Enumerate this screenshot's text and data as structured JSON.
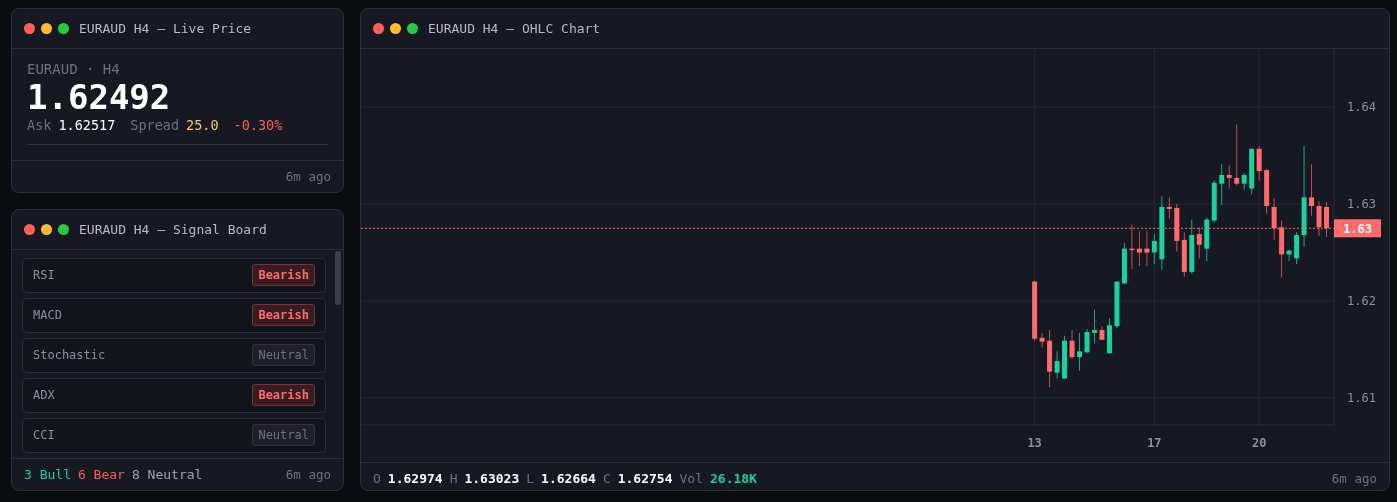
{
  "live_price": {
    "title": "EURAUD H4 — Live Price",
    "symbol": "EURAUD · H4",
    "price": "1.62492",
    "ask_label": "Ask",
    "ask": "1.62517",
    "spread_label": "Spread",
    "spread": "25.0",
    "change": "-0.30%",
    "updated": "6m ago"
  },
  "signal_board": {
    "title": "EURAUD H4 — Signal Board",
    "signals": [
      {
        "name": "RSI",
        "label": "Bearish",
        "kind": "bearish"
      },
      {
        "name": "MACD",
        "label": "Bearish",
        "kind": "bearish"
      },
      {
        "name": "Stochastic",
        "label": "Neutral",
        "kind": "neutral"
      },
      {
        "name": "ADX",
        "label": "Bearish",
        "kind": "bearish"
      },
      {
        "name": "CCI",
        "label": "Neutral",
        "kind": "neutral"
      }
    ],
    "summary": [
      {
        "text": "3 Bull",
        "kind": "bull"
      },
      {
        "text": "6 Bear",
        "kind": "bear"
      },
      {
        "text": "8 Neutral",
        "kind": "neutral"
      }
    ],
    "updated": "6m ago"
  },
  "ohlc_chart": {
    "title": "EURAUD H4 — OHLC Chart",
    "chart_data": {
      "type": "candlestick",
      "grid": true,
      "categories": [
        "13",
        null,
        null,
        null,
        null,
        null,
        null,
        null,
        null,
        null,
        null,
        null,
        null,
        null,
        null,
        null,
        "17",
        null,
        null,
        null,
        null,
        null,
        null,
        null,
        null,
        null,
        null,
        null,
        null,
        null,
        "20",
        null,
        null,
        null,
        null,
        null,
        null,
        null,
        null,
        null
      ],
      "ohlc": [
        [
          1.622,
          1.6221,
          1.6159,
          1.6161
        ],
        [
          1.6162,
          1.6167,
          1.6152,
          1.6158
        ],
        [
          1.6159,
          1.617,
          1.6111,
          1.6127
        ],
        [
          1.6126,
          1.6148,
          1.612,
          1.6138
        ],
        [
          1.612,
          1.6164,
          1.612,
          1.6159
        ],
        [
          1.6159,
          1.617,
          1.614,
          1.6142
        ],
        [
          1.6142,
          1.6167,
          1.6128,
          1.6148
        ],
        [
          1.6147,
          1.6171,
          1.6146,
          1.6168
        ],
        [
          1.6167,
          1.6191,
          1.6156,
          1.617
        ],
        [
          1.617,
          1.6174,
          1.6159,
          1.616
        ],
        [
          1.6146,
          1.6182,
          1.6146,
          1.6175
        ],
        [
          1.6174,
          1.622,
          1.6172,
          1.622
        ],
        [
          1.6218,
          1.626,
          1.6218,
          1.6254
        ],
        [
          1.6254,
          1.6279,
          1.6233,
          1.6253
        ],
        [
          1.6254,
          1.6272,
          1.6236,
          1.625
        ],
        [
          1.6254,
          1.6272,
          1.6236,
          1.625
        ],
        [
          1.625,
          1.6269,
          1.6238,
          1.6262
        ],
        [
          1.6243,
          1.6308,
          1.6232,
          1.6297
        ],
        [
          1.6297,
          1.6307,
          1.6285,
          1.6295
        ],
        [
          1.6296,
          1.63,
          1.6251,
          1.6262
        ],
        [
          1.6263,
          1.6271,
          1.6225,
          1.623
        ],
        [
          1.623,
          1.6284,
          1.6228,
          1.6268
        ],
        [
          1.6269,
          1.6276,
          1.6244,
          1.6258
        ],
        [
          1.6254,
          1.6286,
          1.6241,
          1.6284
        ],
        [
          1.6283,
          1.6324,
          1.6281,
          1.6322
        ],
        [
          1.6321,
          1.6341,
          1.6299,
          1.633
        ],
        [
          1.633,
          1.634,
          1.6316,
          1.6327
        ],
        [
          1.6327,
          1.6382,
          1.6319,
          1.6321
        ],
        [
          1.6321,
          1.6332,
          1.6315,
          1.633
        ],
        [
          1.6316,
          1.6357,
          1.631,
          1.6357
        ],
        [
          1.6357,
          1.636,
          1.6324,
          1.6334
        ],
        [
          1.6335,
          1.6336,
          1.629,
          1.6298
        ],
        [
          1.6297,
          1.6306,
          1.6263,
          1.6275
        ],
        [
          1.6276,
          1.6283,
          1.6224,
          1.6248
        ],
        [
          1.6248,
          1.6253,
          1.6241,
          1.6252
        ],
        [
          1.6244,
          1.6271,
          1.6238,
          1.6268
        ],
        [
          1.6268,
          1.636,
          1.6256,
          1.6307
        ],
        [
          1.6307,
          1.6341,
          1.6288,
          1.6298
        ],
        [
          1.6298,
          1.6303,
          1.6267,
          1.6276
        ],
        [
          1.6297,
          1.6302,
          1.6266,
          1.6275
        ]
      ],
      "ylim": [
        1.6072,
        1.646
      ],
      "yticks": [
        {
          "value": 1.61,
          "label": "1.61"
        },
        {
          "value": 1.62,
          "label": "1.62"
        },
        {
          "value": 1.63,
          "label": "1.63"
        },
        {
          "value": 1.64,
          "label": "1.64"
        }
      ],
      "ref_lines": [
        {
          "axis": "y",
          "value": 1.6275,
          "label": "1.63",
          "color": "#ff6b6b"
        }
      ]
    },
    "ohlc": [
      {
        "label": "O",
        "value": "1.62974"
      },
      {
        "label": "H",
        "value": "1.63023"
      },
      {
        "label": "L",
        "value": "1.62664"
      },
      {
        "label": "C",
        "value": "1.62754"
      }
    ],
    "volume": {
      "label": "Vol",
      "value": "26.18K"
    },
    "updated": "6m ago"
  }
}
